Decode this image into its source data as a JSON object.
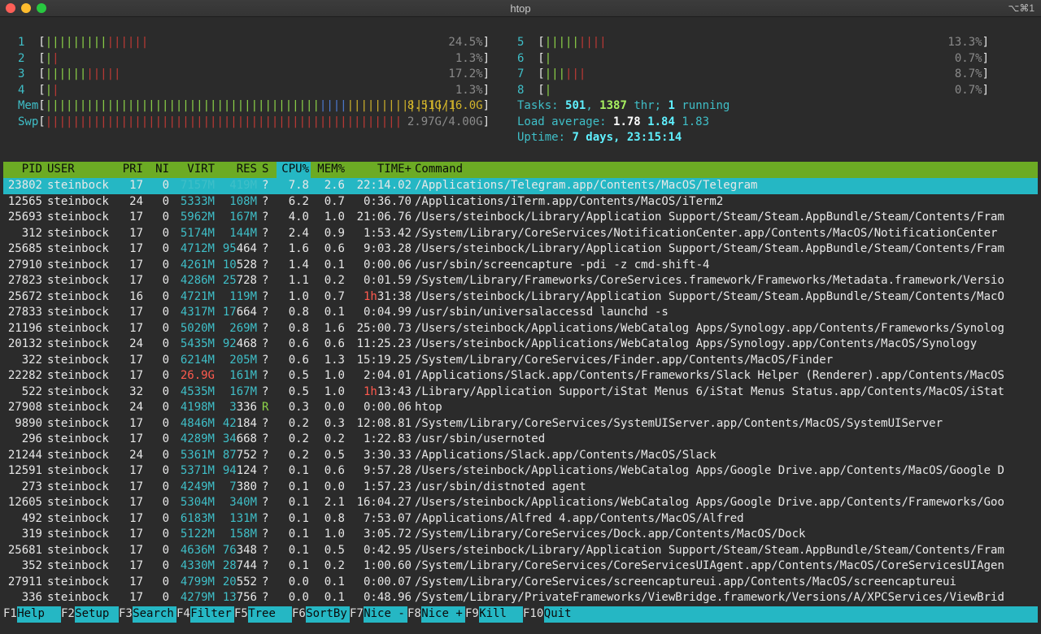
{
  "window": {
    "title": "htop",
    "shortcut": "⌥⌘1"
  },
  "cpus": [
    {
      "num": "1",
      "pct": "24.5%",
      "green": 9,
      "red": 6
    },
    {
      "num": "2",
      "pct": "1.3%",
      "green": 1,
      "red": 1
    },
    {
      "num": "3",
      "pct": "17.2%",
      "green": 6,
      "red": 5
    },
    {
      "num": "4",
      "pct": "1.3%",
      "green": 1,
      "red": 1
    },
    {
      "num": "5",
      "pct": "13.3%",
      "green": 5,
      "red": 4
    },
    {
      "num": "6",
      "pct": "0.7%",
      "green": 1,
      "red": 0
    },
    {
      "num": "7",
      "pct": "8.7%",
      "green": 3,
      "red": 3
    },
    {
      "num": "8",
      "pct": "0.7%",
      "green": 1,
      "red": 0
    }
  ],
  "mem": {
    "label": "Mem",
    "value": "8.51G/16.0G",
    "green": 40,
    "blue": 4,
    "yellow": 16
  },
  "swp": {
    "label": "Swp",
    "value": "2.97G/4.00G",
    "red": 52
  },
  "tasks": {
    "label": "Tasks:",
    "count": "501",
    "thr": "1387",
    "thr_label": "thr;",
    "running": "1",
    "running_label": "running"
  },
  "load": {
    "label": "Load average:",
    "v1": "1.78",
    "v5": "1.84",
    "v15": "1.83"
  },
  "uptime": {
    "label": "Uptime:",
    "value": "7 days, 23:15:14"
  },
  "headers": [
    "PID",
    "USER",
    "PRI",
    "NI",
    "VIRT",
    "RES",
    "S",
    "CPU%",
    "MEM%",
    "TIME+",
    "Command"
  ],
  "processes": [
    {
      "pid": "23802",
      "user": "steinbock",
      "pri": "17",
      "ni": "0",
      "virt": "7157M",
      "res": "419M",
      "s": "?",
      "cpu": "7.8",
      "mem": "2.6",
      "time": "22:14.02",
      "cmd": "/Applications/Telegram.app/Contents/MacOS/Telegram"
    },
    {
      "pid": "12565",
      "user": "steinbock",
      "pri": "24",
      "ni": "0",
      "virt": "5333M",
      "res": "108M",
      "s": "?",
      "cpu": "6.2",
      "mem": "0.7",
      "time": "0:36.70",
      "cmd": "/Applications/iTerm.app/Contents/MacOS/iTerm2"
    },
    {
      "pid": "25693",
      "user": "steinbock",
      "pri": "17",
      "ni": "0",
      "virt": "5962M",
      "res": "167M",
      "s": "?",
      "cpu": "4.0",
      "mem": "1.0",
      "time": "21:06.76",
      "cmd": "/Users/steinbock/Library/Application Support/Steam/Steam.AppBundle/Steam/Contents/Fram"
    },
    {
      "pid": "312",
      "user": "steinbock",
      "pri": "17",
      "ni": "0",
      "virt": "5174M",
      "res": "144M",
      "s": "?",
      "cpu": "2.4",
      "mem": "0.9",
      "time": "1:53.42",
      "cmd": "/System/Library/CoreServices/NotificationCenter.app/Contents/MacOS/NotificationCenter"
    },
    {
      "pid": "25685",
      "user": "steinbock",
      "pri": "17",
      "ni": "0",
      "virt": "4712M",
      "res": "95464",
      "s": "?",
      "cpu": "1.6",
      "mem": "0.6",
      "time": "9:03.28",
      "cmd": "/Users/steinbock/Library/Application Support/Steam/Steam.AppBundle/Steam/Contents/Fram"
    },
    {
      "pid": "27910",
      "user": "steinbock",
      "pri": "17",
      "ni": "0",
      "virt": "4261M",
      "res": "10528",
      "s": "?",
      "cpu": "1.4",
      "mem": "0.1",
      "time": "0:00.06",
      "cmd": "/usr/sbin/screencapture -pdi -z cmd-shift-4"
    },
    {
      "pid": "27823",
      "user": "steinbock",
      "pri": "17",
      "ni": "0",
      "virt": "4286M",
      "res": "25728",
      "s": "?",
      "cpu": "1.1",
      "mem": "0.2",
      "time": "0:01.59",
      "cmd": "/System/Library/Frameworks/CoreServices.framework/Frameworks/Metadata.framework/Versio"
    },
    {
      "pid": "25672",
      "user": "steinbock",
      "pri": "16",
      "ni": "0",
      "virt": "4721M",
      "res": "119M",
      "s": "?",
      "cpu": "1.0",
      "mem": "0.7",
      "time": "1h31:38",
      "cmd": "/Users/steinbock/Library/Application Support/Steam/Steam.AppBundle/Steam/Contents/MacO"
    },
    {
      "pid": "27833",
      "user": "steinbock",
      "pri": "17",
      "ni": "0",
      "virt": "4317M",
      "res": "17664",
      "s": "?",
      "cpu": "0.8",
      "mem": "0.1",
      "time": "0:04.99",
      "cmd": "/usr/sbin/universalaccessd launchd -s"
    },
    {
      "pid": "21196",
      "user": "steinbock",
      "pri": "17",
      "ni": "0",
      "virt": "5020M",
      "res": "269M",
      "s": "?",
      "cpu": "0.8",
      "mem": "1.6",
      "time": "25:00.73",
      "cmd": "/Users/steinbock/Applications/WebCatalog Apps/Synology.app/Contents/Frameworks/Synolog"
    },
    {
      "pid": "20132",
      "user": "steinbock",
      "pri": "24",
      "ni": "0",
      "virt": "5435M",
      "res": "92468",
      "s": "?",
      "cpu": "0.6",
      "mem": "0.6",
      "time": "11:25.23",
      "cmd": "/Users/steinbock/Applications/WebCatalog Apps/Synology.app/Contents/MacOS/Synology"
    },
    {
      "pid": "322",
      "user": "steinbock",
      "pri": "17",
      "ni": "0",
      "virt": "6214M",
      "res": "205M",
      "s": "?",
      "cpu": "0.6",
      "mem": "1.3",
      "time": "15:19.25",
      "cmd": "/System/Library/CoreServices/Finder.app/Contents/MacOS/Finder"
    },
    {
      "pid": "22282",
      "user": "steinbock",
      "pri": "17",
      "ni": "0",
      "virt": "26.9G",
      "res": "161M",
      "s": "?",
      "cpu": "0.5",
      "mem": "1.0",
      "time": "2:04.01",
      "cmd": "/Applications/Slack.app/Contents/Frameworks/Slack Helper (Renderer).app/Contents/MacOS"
    },
    {
      "pid": "522",
      "user": "steinbock",
      "pri": "32",
      "ni": "0",
      "virt": "4535M",
      "res": "167M",
      "s": "?",
      "cpu": "0.5",
      "mem": "1.0",
      "time": "1h13:43",
      "cmd": "/Library/Application Support/iStat Menus 6/iStat Menus Status.app/Contents/MacOS/iStat"
    },
    {
      "pid": "27908",
      "user": "steinbock",
      "pri": "24",
      "ni": "0",
      "virt": "4198M",
      "res": "3336",
      "s": "R",
      "cpu": "0.3",
      "mem": "0.0",
      "time": "0:00.06",
      "cmd": "htop"
    },
    {
      "pid": "9890",
      "user": "steinbock",
      "pri": "17",
      "ni": "0",
      "virt": "4846M",
      "res": "42184",
      "s": "?",
      "cpu": "0.2",
      "mem": "0.3",
      "time": "12:08.81",
      "cmd": "/System/Library/CoreServices/SystemUIServer.app/Contents/MacOS/SystemUIServer"
    },
    {
      "pid": "296",
      "user": "steinbock",
      "pri": "17",
      "ni": "0",
      "virt": "4289M",
      "res": "34668",
      "s": "?",
      "cpu": "0.2",
      "mem": "0.2",
      "time": "1:22.83",
      "cmd": "/usr/sbin/usernoted"
    },
    {
      "pid": "21244",
      "user": "steinbock",
      "pri": "24",
      "ni": "0",
      "virt": "5361M",
      "res": "87752",
      "s": "?",
      "cpu": "0.2",
      "mem": "0.5",
      "time": "3:30.33",
      "cmd": "/Applications/Slack.app/Contents/MacOS/Slack"
    },
    {
      "pid": "12591",
      "user": "steinbock",
      "pri": "17",
      "ni": "0",
      "virt": "5371M",
      "res": "94124",
      "s": "?",
      "cpu": "0.1",
      "mem": "0.6",
      "time": "9:57.28",
      "cmd": "/Users/steinbock/Applications/WebCatalog Apps/Google Drive.app/Contents/MacOS/Google D"
    },
    {
      "pid": "273",
      "user": "steinbock",
      "pri": "17",
      "ni": "0",
      "virt": "4249M",
      "res": "7380",
      "s": "?",
      "cpu": "0.1",
      "mem": "0.0",
      "time": "1:57.23",
      "cmd": "/usr/sbin/distnoted agent"
    },
    {
      "pid": "12605",
      "user": "steinbock",
      "pri": "17",
      "ni": "0",
      "virt": "5304M",
      "res": "340M",
      "s": "?",
      "cpu": "0.1",
      "mem": "2.1",
      "time": "16:04.27",
      "cmd": "/Users/steinbock/Applications/WebCatalog Apps/Google Drive.app/Contents/Frameworks/Goo"
    },
    {
      "pid": "492",
      "user": "steinbock",
      "pri": "17",
      "ni": "0",
      "virt": "6183M",
      "res": "131M",
      "s": "?",
      "cpu": "0.1",
      "mem": "0.8",
      "time": "7:53.07",
      "cmd": "/Applications/Alfred 4.app/Contents/MacOS/Alfred"
    },
    {
      "pid": "319",
      "user": "steinbock",
      "pri": "17",
      "ni": "0",
      "virt": "5122M",
      "res": "158M",
      "s": "?",
      "cpu": "0.1",
      "mem": "1.0",
      "time": "3:05.72",
      "cmd": "/System/Library/CoreServices/Dock.app/Contents/MacOS/Dock"
    },
    {
      "pid": "25681",
      "user": "steinbock",
      "pri": "17",
      "ni": "0",
      "virt": "4636M",
      "res": "76348",
      "s": "?",
      "cpu": "0.1",
      "mem": "0.5",
      "time": "0:42.95",
      "cmd": "/Users/steinbock/Library/Application Support/Steam/Steam.AppBundle/Steam/Contents/Fram"
    },
    {
      "pid": "352",
      "user": "steinbock",
      "pri": "17",
      "ni": "0",
      "virt": "4330M",
      "res": "28744",
      "s": "?",
      "cpu": "0.1",
      "mem": "0.2",
      "time": "1:00.60",
      "cmd": "/System/Library/CoreServices/CoreServicesUIAgent.app/Contents/MacOS/CoreServicesUIAgen"
    },
    {
      "pid": "27911",
      "user": "steinbock",
      "pri": "17",
      "ni": "0",
      "virt": "4799M",
      "res": "20552",
      "s": "?",
      "cpu": "0.0",
      "mem": "0.1",
      "time": "0:00.07",
      "cmd": "/System/Library/CoreServices/screencaptureui.app/Contents/MacOS/screencaptureui"
    },
    {
      "pid": "336",
      "user": "steinbock",
      "pri": "17",
      "ni": "0",
      "virt": "4279M",
      "res": "13756",
      "s": "?",
      "cpu": "0.0",
      "mem": "0.1",
      "time": "0:48.96",
      "cmd": "/System/Library/PrivateFrameworks/ViewBridge.framework/Versions/A/XPCServices/ViewBrid"
    }
  ],
  "footer": [
    {
      "key": "F1",
      "label": "Help"
    },
    {
      "key": "F2",
      "label": "Setup"
    },
    {
      "key": "F3",
      "label": "Search"
    },
    {
      "key": "F4",
      "label": "Filter"
    },
    {
      "key": "F5",
      "label": "Tree"
    },
    {
      "key": "F6",
      "label": "SortBy"
    },
    {
      "key": "F7",
      "label": "Nice -"
    },
    {
      "key": "F8",
      "label": "Nice +"
    },
    {
      "key": "F9",
      "label": "Kill"
    },
    {
      "key": "F10",
      "label": "Quit"
    }
  ],
  "colors": {
    "selection": "#25b7c4",
    "header": "#6cab24",
    "cyan": "#3fbfc8",
    "green": "#8dd448",
    "red": "#c03a35"
  }
}
